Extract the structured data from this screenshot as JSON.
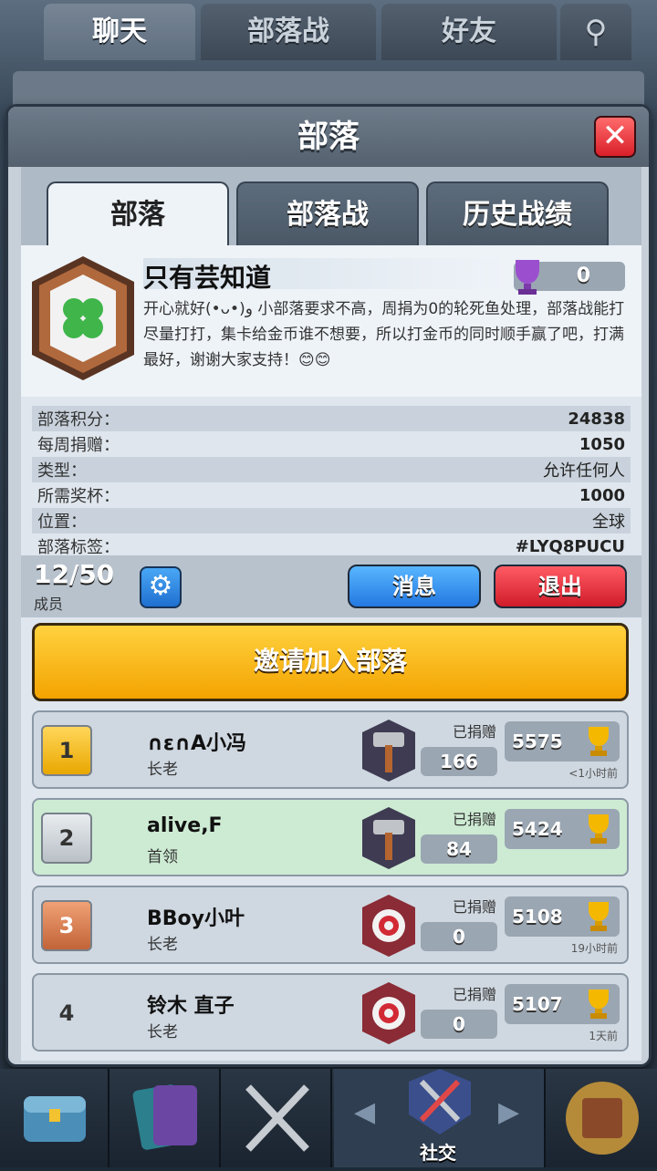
{
  "top_tabs": [
    "聊天",
    "部落战",
    "好友"
  ],
  "behind_text": "只有芸知道",
  "modal": {
    "title": "部落",
    "tabs": [
      "部落",
      "部落战",
      "历史战绩"
    ]
  },
  "clan": {
    "name": "只有芸知道",
    "trophies": "0",
    "description": "开心就好(•ᴗ•)و 小部落要求不高，周捐为0的轮死鱼处理，部落战能打尽量打打，集卡给金币谁不想要，所以打金币的同时顺手赢了吧，打满最好，谢谢大家支持！😊😊",
    "stats": [
      {
        "label": "部落积分：",
        "value": "24838"
      },
      {
        "label": "每周捐赠：",
        "value": "1050"
      },
      {
        "label": "类型：",
        "value": "允许任何人"
      },
      {
        "label": "所需奖杯：",
        "value": "1000"
      },
      {
        "label": "位置：",
        "value": "全球"
      },
      {
        "label": "部落标签：",
        "value": "#LYQ8PUCU"
      }
    ]
  },
  "members": {
    "count": "12/50",
    "label": "成员",
    "message_button": "消息",
    "leave_button": "退出"
  },
  "invite_button": "邀请加入部落",
  "donated_label": "已捐赠",
  "member_list": [
    {
      "rank": "1",
      "name": "∩ε∩A小冯",
      "role": "长老",
      "donated": "166",
      "trophies": "5575",
      "time": "<1小时前"
    },
    {
      "rank": "2",
      "name": "alive,F",
      "role": "首领",
      "donated": "84",
      "trophies": "5424",
      "time": ""
    },
    {
      "rank": "3",
      "name": "BBoy小叶",
      "role": "长老",
      "donated": "0",
      "trophies": "5108",
      "time": "19小时前"
    },
    {
      "rank": "4",
      "name": "铃木 直子",
      "role": "长老",
      "donated": "0",
      "trophies": "5107",
      "time": "1天前"
    }
  ],
  "bottom_nav": {
    "active_label": "社交"
  },
  "colors": {
    "accent_yellow": "#f3a300",
    "blue_button": "#2478e0",
    "red_button": "#d01c2a"
  }
}
